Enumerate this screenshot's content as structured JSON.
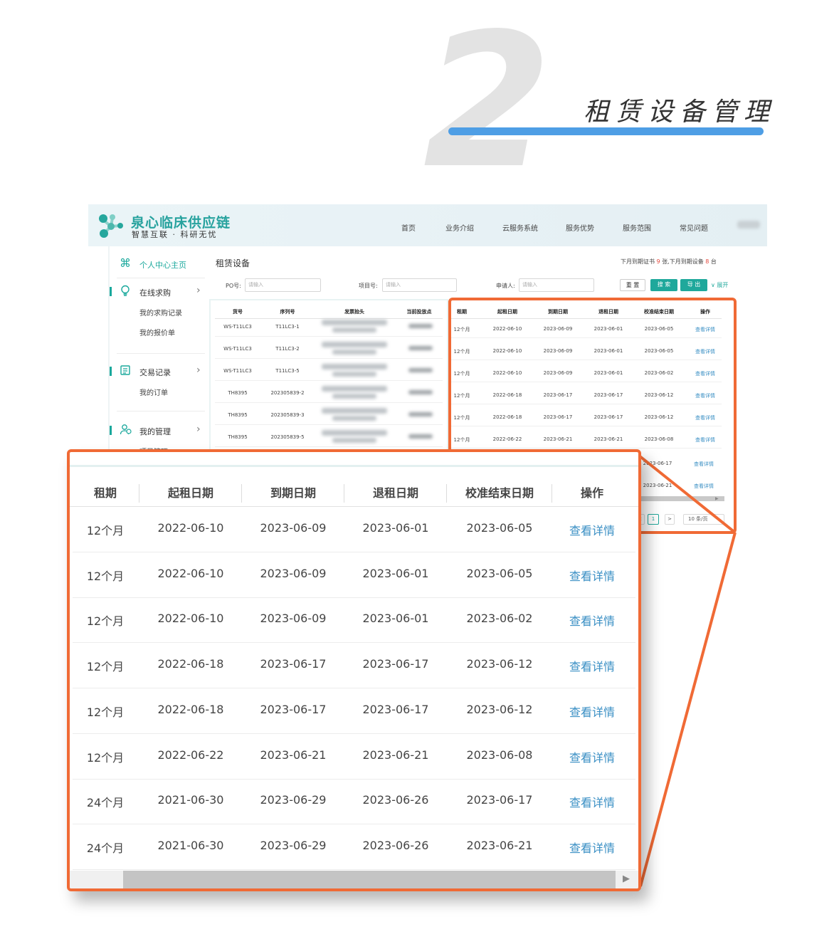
{
  "hero": {
    "number": "2",
    "title": "租赁设备管理"
  },
  "header": {
    "brand": "泉心临床供应链",
    "slogan": "智慧互联 · 科研无忧",
    "nav": [
      "首页",
      "业务介绍",
      "云服务系统",
      "服务优势",
      "服务范围",
      "常见问题"
    ]
  },
  "sidebar": {
    "home": {
      "icon": "command-icon",
      "label": "个人中心主页"
    },
    "purchase": {
      "icon": "lightbulb-icon",
      "label": "在线求购",
      "subs": [
        "我的求购记录",
        "我的报价单"
      ]
    },
    "trade": {
      "icon": "receipt-icon",
      "label": "交易记录",
      "subs": [
        "我的订单"
      ]
    },
    "manage": {
      "icon": "users-icon",
      "label": "我的管理",
      "subs": [
        "项目管理"
      ]
    }
  },
  "page": {
    "title": "租赁设备",
    "stats": {
      "pre": "下月到期证书",
      "cert": "9",
      "mid": "张,下月到期设备",
      "device": "8",
      "post": "台"
    },
    "filters": [
      {
        "label": "PO号:",
        "placeholder": "请输入"
      },
      {
        "label": "项目号:",
        "placeholder": "请输入"
      },
      {
        "label": "申请人:",
        "placeholder": "请输入"
      }
    ],
    "buttons": {
      "reset": "重 置",
      "search": "搜 索",
      "export": "导 出",
      "expand": "展开"
    }
  },
  "left_table": {
    "headers": [
      "货号",
      "序列号",
      "发票抬头",
      "当前投放点"
    ],
    "rows": [
      [
        "WS-T11LC3",
        "T11LC3-1"
      ],
      [
        "WS-T11LC3",
        "T11LC3-2"
      ],
      [
        "WS-T11LC3",
        "T11LC3-5"
      ],
      [
        "TH8395",
        "202305839-2"
      ],
      [
        "TH8395",
        "202305839-3"
      ],
      [
        "TH8395",
        "202305839-5"
      ]
    ]
  },
  "lease_table": {
    "headers": [
      "租期",
      "起租日期",
      "到期日期",
      "退租日期",
      "校准结束日期",
      "操作"
    ],
    "rows": [
      [
        "12个月",
        "2022-06-10",
        "2023-06-09",
        "2023-06-01",
        "2023-06-05",
        "查看详情"
      ],
      [
        "12个月",
        "2022-06-10",
        "2023-06-09",
        "2023-06-01",
        "2023-06-05",
        "查看详情"
      ],
      [
        "12个月",
        "2022-06-10",
        "2023-06-09",
        "2023-06-01",
        "2023-06-02",
        "查看详情"
      ],
      [
        "12个月",
        "2022-06-18",
        "2023-06-17",
        "2023-06-17",
        "2023-06-12",
        "查看详情"
      ],
      [
        "12个月",
        "2022-06-18",
        "2023-06-17",
        "2023-06-17",
        "2023-06-12",
        "查看详情"
      ],
      [
        "12个月",
        "2022-06-22",
        "2023-06-21",
        "2023-06-21",
        "2023-06-08",
        "查看详情"
      ],
      [
        "24个月",
        "2021-06-30",
        "2023-06-29",
        "2023-06-26",
        "2023-06-17",
        "查看详情"
      ],
      [
        "24个月",
        "2021-06-30",
        "2023-06-29",
        "2023-06-26",
        "2023-06-21",
        "查看详情"
      ]
    ]
  },
  "pager": {
    "page": "1",
    "prev": "<",
    "next": ">",
    "size": "10 条/页"
  },
  "colors": {
    "brand": "#1fa89b",
    "accent_orange": "#f06a35",
    "title_bar": "#4e9ee5",
    "link": "#3a8fc4",
    "alert": "#e4473c"
  }
}
